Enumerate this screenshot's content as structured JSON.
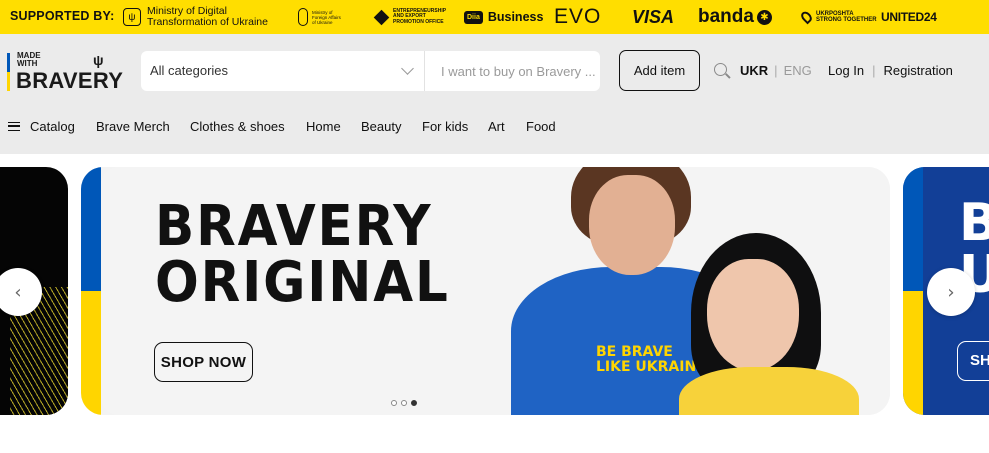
{
  "sponsors": {
    "label": "SUPPORTED BY:",
    "ministry": "Ministry of Digital\nTransformation of Ukraine",
    "mfa": "Ministry of\nForeign Affairs\nof Ukraine",
    "epo": "ENTREPRENEURSHIP\nAND EXPORT\nPROMOTION OFFICE",
    "diia_badge": "Diia",
    "diia": "Business",
    "evo": "EVO",
    "visa": "VISA",
    "banda": "banda",
    "ukrposhta": "UKRPOSHTA\nSTRONG TOGETHER",
    "united24": "UNITED24"
  },
  "logo": {
    "made_with": "MADE\nWITH",
    "word": "BRAVERY",
    "trident": "ψ"
  },
  "search": {
    "category": "All categories",
    "placeholder": "I want to buy on Bravery ..."
  },
  "header": {
    "add_item": "Add item",
    "lang_active": "UKR",
    "lang_sep": "|",
    "lang_inactive": "ENG",
    "login": "Log In",
    "auth_sep": "|",
    "register": "Registration"
  },
  "nav": {
    "items": [
      "Catalog",
      "Brave Merch",
      "Clothes & shoes",
      "Home",
      "Beauty",
      "For kids",
      "Art",
      "Food"
    ]
  },
  "banner": {
    "headline": "BRAVERY\nORIGINAL",
    "cta": "SHOP NOW",
    "shirt_text": "BE BRAVE\nLIKE UKRAINE",
    "next_slide_text": "B\nU",
    "next_slide_cta": "SH",
    "active_dot": 3,
    "dot_count": 3
  },
  "colors": {
    "sponsor_bg": "#ffde00",
    "header_bg": "#ebebeb",
    "ua_blue": "#0057b8",
    "ua_yellow": "#ffd500"
  },
  "icons": {
    "search": "magnifier-icon",
    "dropdown": "chevron-down-icon",
    "menu": "hamburger-icon",
    "prev": "chevron-left-icon",
    "next": "chevron-right-icon"
  }
}
